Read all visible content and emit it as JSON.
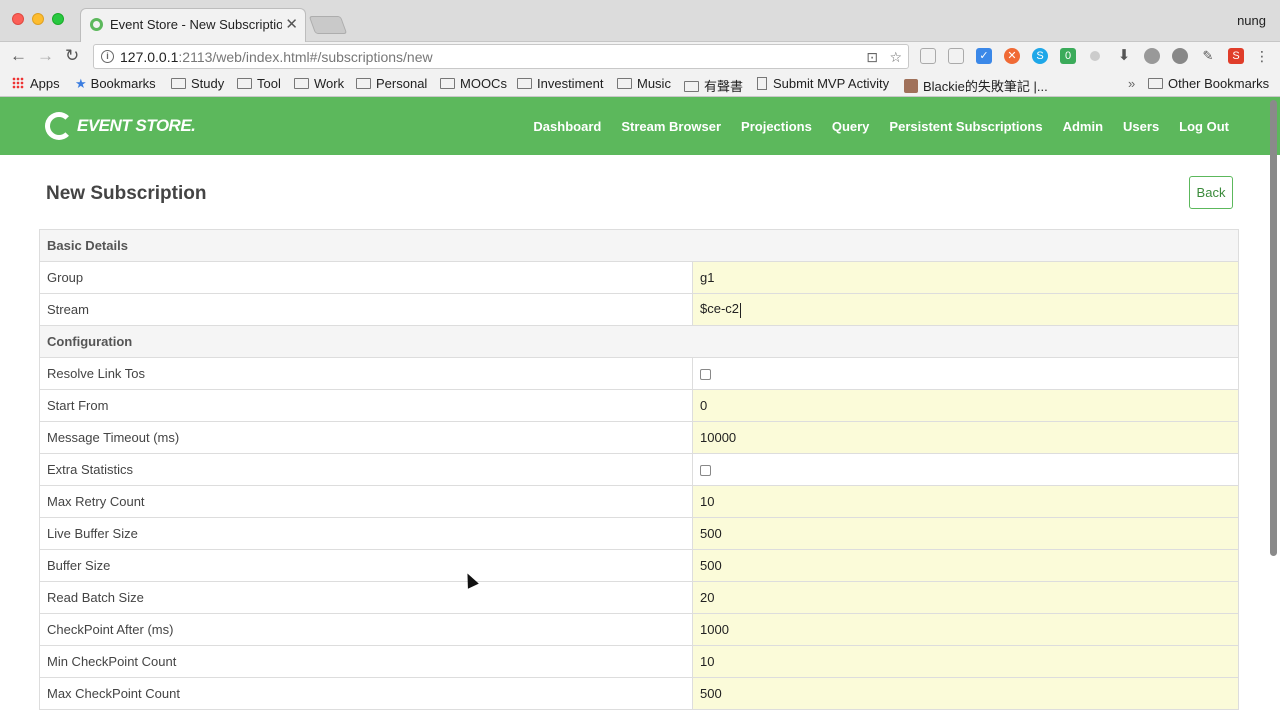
{
  "browser": {
    "tab_title": "Event Store - New Subscription",
    "profile_name": "nung",
    "url_host": "127.0.0.1",
    "url_rest": ":2113/web/index.html#/subscriptions/new",
    "bookmarks": [
      "Apps",
      "Bookmarks",
      "Study",
      "Tool",
      "Work",
      "Personal",
      "MOOCs",
      "Investiment",
      "Music",
      "有聲書",
      "Submit MVP Activity",
      "Blackie的失敗筆記 |...",
      "Other Bookmarks"
    ],
    "overflow_label": "»",
    "ext_badge": "0",
    "ext_s_red": "S"
  },
  "header": {
    "logo_text": "EVENT STORE.",
    "nav": [
      "Dashboard",
      "Stream Browser",
      "Projections",
      "Query",
      "Persistent Subscriptions",
      "Admin",
      "Users",
      "Log Out"
    ]
  },
  "page": {
    "title": "New Subscription",
    "back_label": "Back"
  },
  "form": {
    "basic_details": "Basic Details",
    "group_label": "Group",
    "group_value": "g1",
    "stream_label": "Stream",
    "stream_value": "$ce-c2",
    "configuration": "Configuration",
    "resolve_label": "Resolve Link Tos",
    "start_from_label": "Start From",
    "start_from_value": "0",
    "msg_timeout_label": "Message Timeout (ms)",
    "msg_timeout_value": "10000",
    "extra_stats_label": "Extra Statistics",
    "max_retry_label": "Max Retry Count",
    "max_retry_value": "10",
    "live_buffer_label": "Live Buffer Size",
    "live_buffer_value": "500",
    "buffer_label": "Buffer Size",
    "buffer_value": "500",
    "read_batch_label": "Read Batch Size",
    "read_batch_value": "20",
    "checkpoint_after_label": "CheckPoint After (ms)",
    "checkpoint_after_value": "1000",
    "min_checkpoint_label": "Min CheckPoint Count",
    "min_checkpoint_value": "10",
    "max_checkpoint_label": "Max CheckPoint Count",
    "max_checkpoint_value": "500"
  }
}
